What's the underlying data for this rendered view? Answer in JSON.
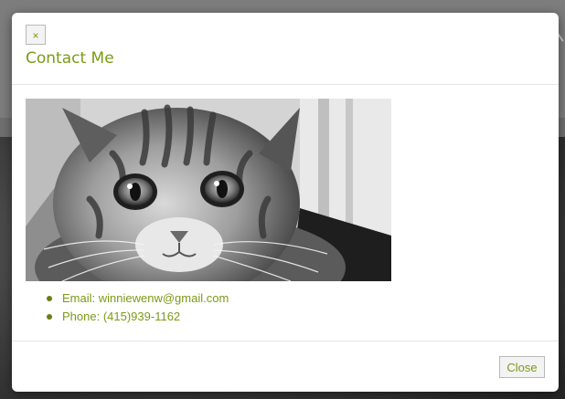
{
  "modal": {
    "close_symbol": "×",
    "title": "Contact Me",
    "contacts": [
      {
        "label": "Email:",
        "value": "winniewenw@gmail.com"
      },
      {
        "label": "Phone:",
        "value": "(415)939-1162"
      }
    ],
    "image_icon": "kitten-photo",
    "footer": {
      "close_label": "Close"
    }
  },
  "colors": {
    "accent": "#7a9a16",
    "bullet": "#6b7d14",
    "button_bg": "#f3f3f3",
    "button_border": "#b9b9b9",
    "divider": "#e5e5e5",
    "backdrop": "#5f5f5f"
  }
}
